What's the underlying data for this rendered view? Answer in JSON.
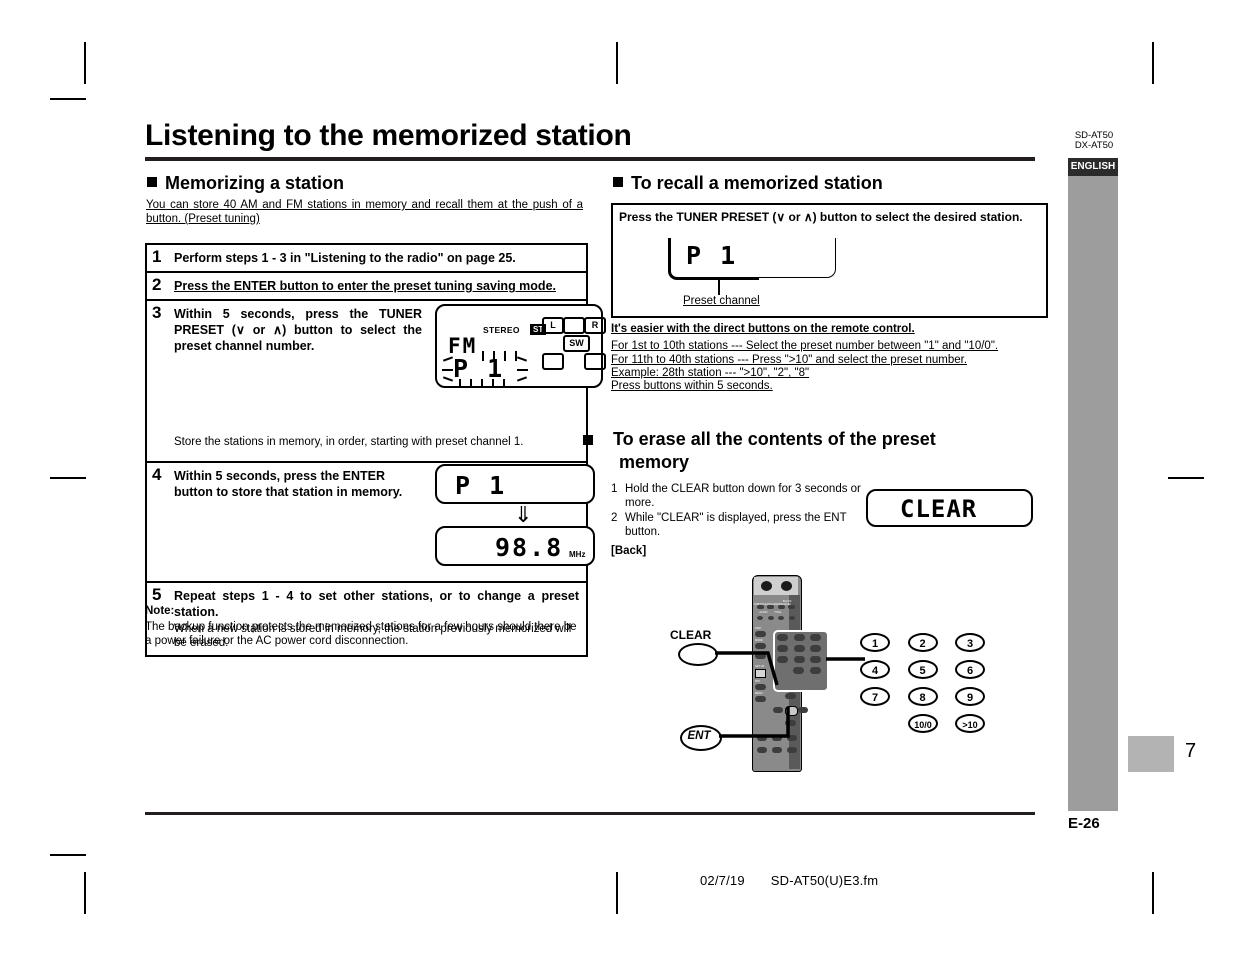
{
  "document": {
    "title": "Listening to the memorized station",
    "language_tab": "ENGLISH",
    "models": [
      "SD-AT50",
      "DX-AT50"
    ],
    "edition_code": "E-26",
    "page_number": "7",
    "footer": {
      "date": "02/7/19",
      "filename": "SD-AT50(U)E3.fm"
    }
  },
  "memorizing": {
    "heading": "Memorizing a station",
    "intro": "You can store 40 AM and FM stations in memory and recall them at the push of a button. (Preset tuning)",
    "steps": [
      {
        "num": "1",
        "title": "Perform steps 1 - 3 in \"Listening to the radio\" on page 25.",
        "sub": ""
      },
      {
        "num": "2",
        "title": "Press the ENTER button to enter the preset tuning saving mode.",
        "sub": ""
      },
      {
        "num": "3",
        "title": "Within 5 seconds, press the TUNER PRESET (∨ or ∧) button to select the preset channel number.",
        "sub": "Store the stations in memory, in order, starting with preset channel 1."
      },
      {
        "num": "4",
        "title": "Within 5 seconds, press the ENTER button to store that station in memory.",
        "sub": ""
      },
      {
        "num": "5",
        "title": "Repeat steps 1 - 4 to set other stations, or to change a preset station.",
        "sub": "When a new station is stored in memory, the station previously memorized will be erased."
      }
    ],
    "display_step3": {
      "stereo_label": "STEREO",
      "st_badge": "ST",
      "band": "FM",
      "preset": "P 1",
      "speaker_left": "L",
      "speaker_center": "",
      "speaker_right": "R",
      "subwoofer": "SW"
    },
    "display_step4": {
      "preset": "P 1",
      "arrow": "⇓",
      "frequency": "98.8",
      "unit": "MHz"
    },
    "note": {
      "label": "Note:",
      "text": "The backup function protects the memorized stations for a few hours should there be a power failure or the AC power cord disconnection."
    }
  },
  "recall": {
    "heading": "To recall a memorized station",
    "instruction": "Press the TUNER PRESET (∨ or ∧) button to select the desired station.",
    "display": {
      "preset": "P 1"
    },
    "callout_label": "Preset channel",
    "direct_buttons": {
      "headline": "It's easier with the direct buttons on the remote control.",
      "lines": [
        "For 1st to 10th stations --- Select the preset number between \"1\" and \"10/0\".",
        "For 11th to 40th stations --- Press \">10\" and select the preset number.",
        "Example: 28th station --- \">10\", \"2\", \"8\"",
        "Press buttons within 5 seconds."
      ]
    }
  },
  "erase": {
    "heading_line1": "To erase all the contents of the preset",
    "heading_line2": "memory",
    "steps": [
      {
        "num": "1",
        "text": "Hold the CLEAR button down for 3 seconds or more."
      },
      {
        "num": "2",
        "text": "While \"CLEAR\" is displayed, press the ENT button."
      }
    ],
    "display": {
      "text": "CLEAR"
    },
    "back_label": "[Back]"
  },
  "remote": {
    "clear_label": "CLEAR",
    "ent_label": "ENT",
    "keypad": [
      "1",
      "2",
      "3",
      "4",
      "5",
      "6",
      "7",
      "8",
      "9",
      "10/0",
      ">10"
    ],
    "top_labels": [
      "SUBTITLE",
      "ANGLE",
      "MODE",
      "BLACK LEVEL"
    ],
    "second_labels": [
      "AUDIO",
      "TITLE"
    ],
    "left_labels": [
      "DISC",
      "MODE",
      "SET UP",
      "RTN",
      "MENU"
    ]
  },
  "colors": {
    "rule": "#231f20",
    "sidebar": "#9d9d9d",
    "lang_tab": "#2b2b2b",
    "page_tab": "#b3b3b3",
    "remote_body": "#8a8a8a",
    "remote_dark": "#5a5a5a"
  }
}
